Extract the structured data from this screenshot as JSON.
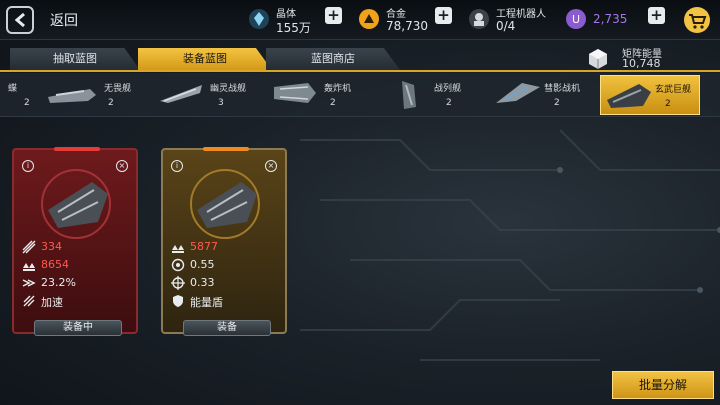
{
  "header": {
    "back_label": "返回",
    "resources": [
      {
        "name": "晶体",
        "value": "155万",
        "icon": "crystal-icon",
        "color": "#6ec0e8"
      },
      {
        "name": "合金",
        "value": "78,730",
        "icon": "alloy-icon",
        "color": "#f0a21a"
      },
      {
        "name": "工程机器人",
        "value": "0/4",
        "icon": "robot-icon",
        "color": "#d6dadd"
      }
    ],
    "premium": {
      "value": "2,735",
      "icon": "u-coin-icon",
      "color": "#a974e8"
    },
    "shop_icon": "cart-icon"
  },
  "tabs": [
    {
      "label": "抽取蓝图",
      "active": false
    },
    {
      "label": "装备蓝图",
      "active": true
    },
    {
      "label": "蓝图商店",
      "active": false
    }
  ],
  "matrix_energy": {
    "name": "矩阵能量",
    "value": "10,748",
    "icon": "cube-icon"
  },
  "ships": [
    {
      "name": "蝶",
      "count": "2",
      "selected": false
    },
    {
      "name": "无畏舰",
      "count": "2",
      "selected": false
    },
    {
      "name": "幽灵战舰",
      "count": "3",
      "selected": false
    },
    {
      "name": "轰炸机",
      "count": "2",
      "selected": false
    },
    {
      "name": "战列舰",
      "count": "2",
      "selected": false
    },
    {
      "name": "彗影战机",
      "count": "2",
      "selected": false
    },
    {
      "name": "玄武巨舰",
      "count": "2",
      "selected": true
    }
  ],
  "cards": [
    {
      "theme": "red",
      "stats": [
        {
          "icon": "attack-icon",
          "value": "334",
          "color": "#ff5a4e"
        },
        {
          "icon": "hp-icon",
          "value": "8654",
          "color": "#ff5a4e"
        },
        {
          "icon": "speed-icon",
          "value": "23.2%",
          "color": "#e8ecef"
        },
        {
          "icon": "accelerate-icon",
          "value": "加速",
          "color": "#e8ecef"
        }
      ],
      "button_label": "装备中"
    },
    {
      "theme": "gold",
      "stats": [
        {
          "icon": "hp-icon",
          "value": "5877",
          "color": "#ff5a4e"
        },
        {
          "icon": "target-circle-icon",
          "value": "0.55",
          "color": "#e8ecef"
        },
        {
          "icon": "crosshair-icon",
          "value": "0.33",
          "color": "#e8ecef"
        },
        {
          "icon": "shield-icon",
          "value": "能量盾",
          "color": "#e8ecef"
        }
      ],
      "button_label": "装备"
    }
  ],
  "bulk_button_label": "批量分解"
}
